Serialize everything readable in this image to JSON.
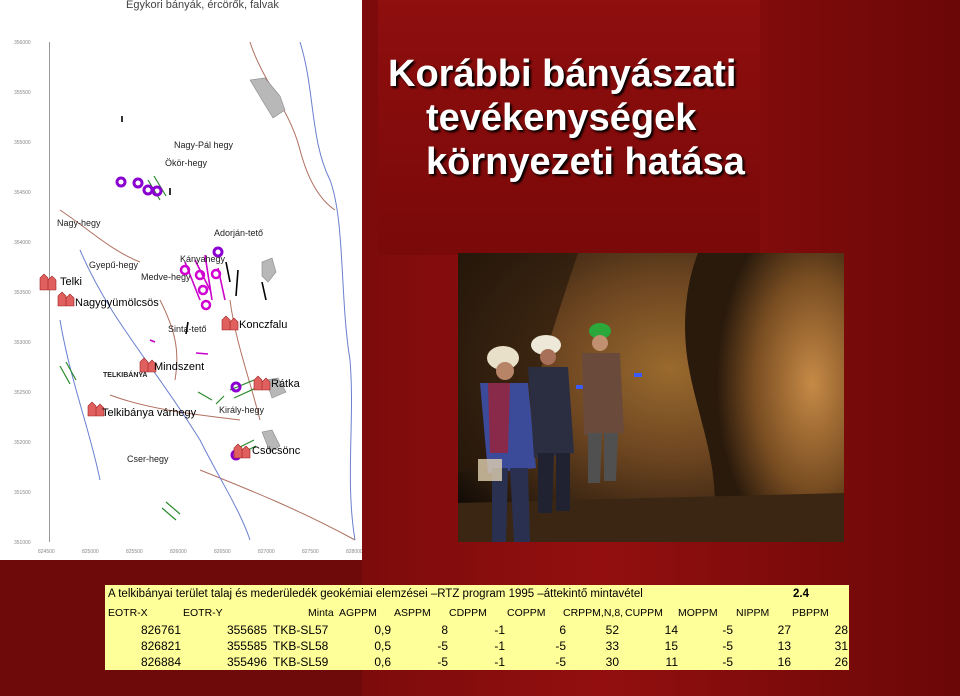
{
  "map": {
    "caption": "Egykori bányák, ércörők, falvak",
    "places": [
      {
        "name": "Nagy-Pál hegy",
        "kind": "hill"
      },
      {
        "name": "Ökör-hegy",
        "kind": "hill"
      },
      {
        "name": "Nagy-hegy",
        "kind": "hill"
      },
      {
        "name": "Adorján-tető",
        "kind": "hill"
      },
      {
        "name": "Gyepű-hegy",
        "kind": "hill"
      },
      {
        "name": "Kányahegy",
        "kind": "hill"
      },
      {
        "name": "Medve-hegy",
        "kind": "hill"
      },
      {
        "name": "Telki",
        "kind": "town"
      },
      {
        "name": "Nagygyümölcsös",
        "kind": "town"
      },
      {
        "name": "Sinta-tető",
        "kind": "hill"
      },
      {
        "name": "Konczfalu",
        "kind": "town"
      },
      {
        "name": "TELKIBÁNYA",
        "kind": "hill"
      },
      {
        "name": "Mindszent",
        "kind": "town"
      },
      {
        "name": "Rátka",
        "kind": "town"
      },
      {
        "name": "Telkibánya várhegy",
        "kind": "town"
      },
      {
        "name": "Király-hegy",
        "kind": "hill"
      },
      {
        "name": "Csöcsönc",
        "kind": "town"
      },
      {
        "name": "Cser-hegy",
        "kind": "hill"
      }
    ]
  },
  "title": {
    "line1": "Korábbi bányászati",
    "line2": "tevékenységek",
    "line3": "környezeti hatása"
  },
  "photo": {
    "subject": "mine-tunnel-miners-photo"
  },
  "table": {
    "title": "A telkibányai terület talaj és mederüledék geokémiai elemzései –RTZ program 1995 –áttekintő mintavétel",
    "number": "2.4",
    "headers": [
      "EOTR-X",
      "EOTR-Y",
      "Minta",
      "AGPPM",
      "ASPPM",
      "CDPPM",
      "COPPM",
      "CRPPM,N,8,",
      "CUPPM",
      "MOPPM",
      "NIPPM",
      "PBPPM"
    ],
    "rows": [
      [
        "826761",
        "355685",
        "TKB-SL57",
        "0,9",
        "8",
        "-1",
        "6",
        "52",
        "14",
        "-5",
        "27",
        "28"
      ],
      [
        "826821",
        "355585",
        "TKB-SL58",
        "0,5",
        "-5",
        "-1",
        "-5",
        "33",
        "15",
        "-5",
        "13",
        "31"
      ],
      [
        "826884",
        "355496",
        "TKB-SL59",
        "0,6",
        "-5",
        "-1",
        "-5",
        "30",
        "11",
        "-5",
        "16",
        "26"
      ]
    ]
  },
  "colors": {
    "background": "#6e0a0a",
    "table_bg": "#ffff99",
    "mine_marker": "#8800cc",
    "vein": "#cc00cc"
  }
}
